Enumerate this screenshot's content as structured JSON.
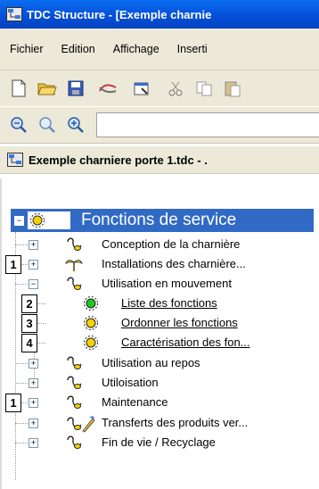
{
  "window": {
    "title": "TDC Structure - [Exemple charnie"
  },
  "menu": [
    "Fichier",
    "Edition",
    "Affichage",
    "Inserti"
  ],
  "document": {
    "title": "Exemple charniere porte 1.tdc - ."
  },
  "tree": {
    "root": {
      "label": "Fonctions de service",
      "expander": "−"
    },
    "items": [
      {
        "label": "Conception de la charnière",
        "expander": "+",
        "callout": ""
      },
      {
        "label": "Installations des charnière...",
        "expander": "+",
        "callout": "1"
      },
      {
        "label": "Utilisation en mouvement",
        "expander": "−",
        "callout": ""
      },
      {
        "label": "Liste des fonctions",
        "expander": "",
        "callout": "2"
      },
      {
        "label": "Ordonner les fonctions",
        "expander": "",
        "callout": "3"
      },
      {
        "label": "Caractérisation des fon...",
        "expander": "",
        "callout": "4"
      },
      {
        "label": "Utilisation au repos",
        "expander": "+",
        "callout": ""
      },
      {
        "label": "Utiloisation",
        "expander": "+",
        "callout": ""
      },
      {
        "label": "Maintenance",
        "expander": "+",
        "callout": "1"
      },
      {
        "label": "Transferts des produits ver...",
        "expander": "+",
        "callout": ""
      },
      {
        "label": "Fin de vie / Recyclage",
        "expander": "+",
        "callout": ""
      }
    ]
  }
}
